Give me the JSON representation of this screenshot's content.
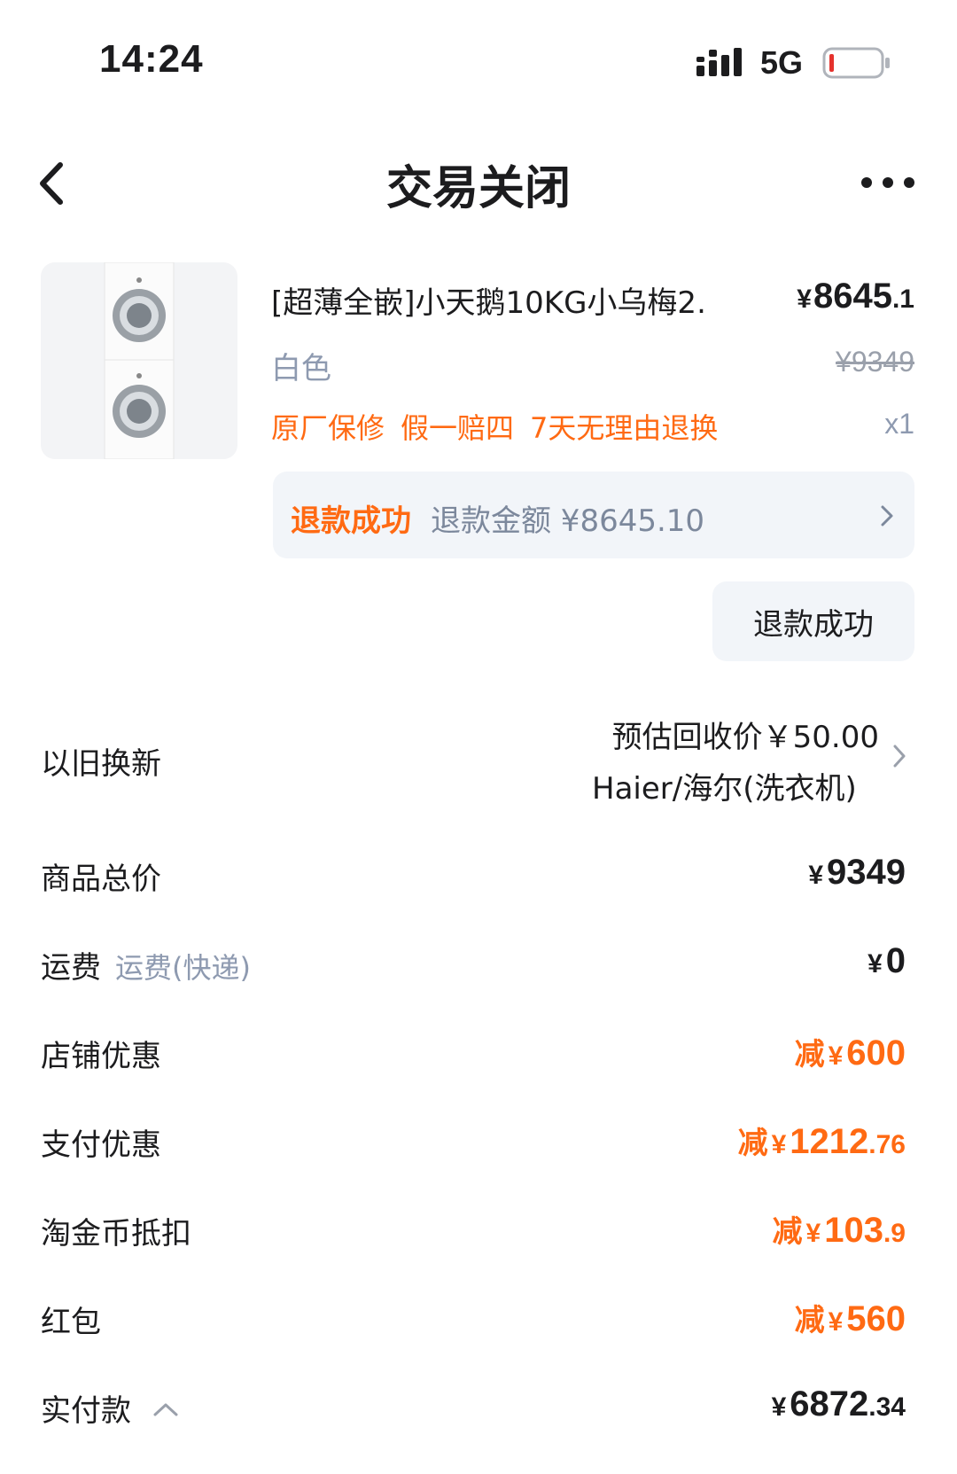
{
  "status_bar": {
    "time": "14:24",
    "network": "5G"
  },
  "nav": {
    "title": "交易关闭"
  },
  "product": {
    "title": "[超薄全嵌]小天鹅10KG小乌梅2.",
    "price_symbol": "¥",
    "price_int": "8645",
    "price_dec": ".1",
    "variant": "白色",
    "original_price": "¥9349",
    "tags": [
      "原厂保修",
      "假一赔四",
      "7天无理由退换"
    ],
    "quantity": "x1"
  },
  "refund": {
    "status": "退款成功",
    "amount_label": "退款金额 ¥8645.10",
    "button_label": "退款成功"
  },
  "summary": {
    "trade_in": {
      "label": "以旧换新",
      "estimate": "预估回收价￥50.00",
      "device": "Haier/海尔(洗衣机)"
    },
    "total": {
      "label": "商品总价",
      "yen": "¥",
      "int": "9349"
    },
    "shipping": {
      "label": "运费",
      "sub": "运费(快递)",
      "yen": "¥",
      "int": "0"
    },
    "store_discount": {
      "label": "店铺优惠",
      "prefix": "减",
      "yen": "¥",
      "int": "600"
    },
    "payment_discount": {
      "label": "支付优惠",
      "prefix": "减",
      "yen": "¥",
      "int": "1212",
      "dec": ".76"
    },
    "coins": {
      "label": "淘金币抵扣",
      "prefix": "减",
      "yen": "¥",
      "int": "103",
      "dec": ".9"
    },
    "red_packet": {
      "label": "红包",
      "prefix": "减",
      "yen": "¥",
      "int": "560"
    },
    "paid": {
      "label": "实付款",
      "yen": "¥",
      "int": "6872",
      "dec": ".34"
    }
  },
  "colors": {
    "accent": "#ff6a13",
    "muted": "#8e9ab0",
    "card_bg": "#f2f5f9"
  }
}
